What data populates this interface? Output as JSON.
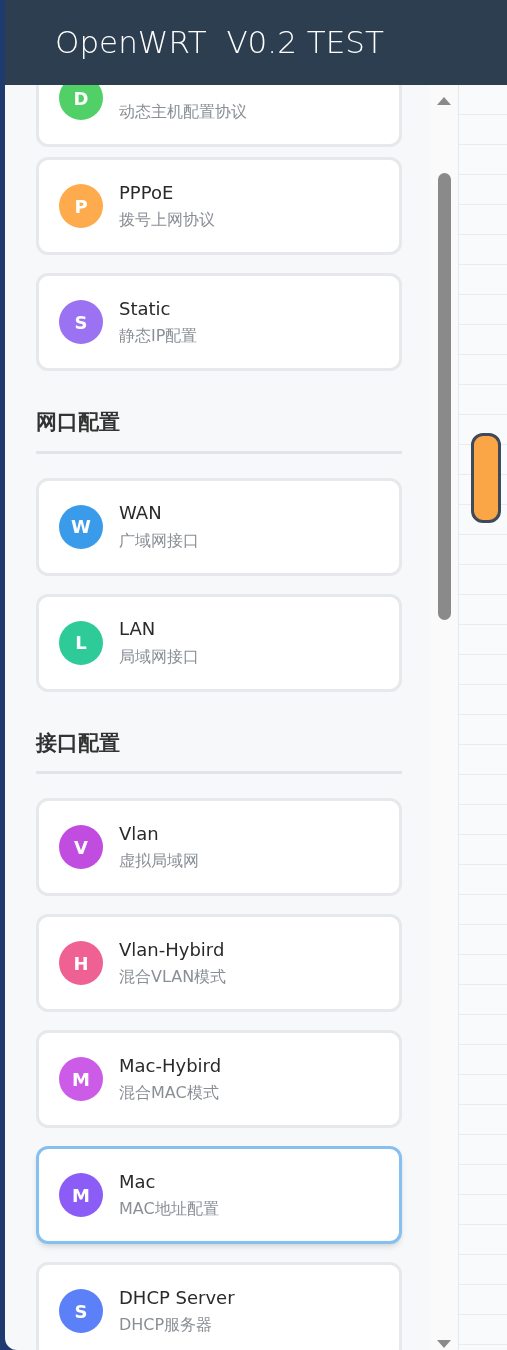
{
  "header": {
    "title": "OpenWRT  V0.2 TEST"
  },
  "sections": [
    {
      "items": [
        {
          "letter": "D",
          "subtitle": "动态主机配置协议",
          "color": "#52d068",
          "selected": false
        },
        {
          "letter": "P",
          "title": "PPPoE",
          "subtitle": "拨号上网协议",
          "color": "#fdab4d",
          "selected": false
        },
        {
          "letter": "S",
          "title": "Static",
          "subtitle": "静态IP配置",
          "color": "#9b72f2",
          "selected": false
        }
      ]
    },
    {
      "heading": "网口配置",
      "items": [
        {
          "letter": "W",
          "title": "WAN",
          "subtitle": "广域网接口",
          "color": "#3a9bea",
          "selected": false
        },
        {
          "letter": "L",
          "title": "LAN",
          "subtitle": "局域网接口",
          "color": "#2ecb98",
          "selected": false
        }
      ]
    },
    {
      "heading": "接口配置",
      "items": [
        {
          "letter": "V",
          "title": "Vlan",
          "subtitle": "虚拟局域网",
          "color": "#c04ce0",
          "selected": false
        },
        {
          "letter": "H",
          "title": "Vlan-Hybird",
          "subtitle": "混合VLAN模式",
          "color": "#ef6193",
          "selected": false
        },
        {
          "letter": "M",
          "title": "Mac-Hybird",
          "subtitle": "混合MAC模式",
          "color": "#cc5ce8",
          "selected": false
        },
        {
          "letter": "M",
          "title": "Mac",
          "subtitle": "MAC地址配置",
          "color": "#8b5cf6",
          "selected": true
        },
        {
          "letter": "S",
          "title": "DHCP Server",
          "subtitle": "DHCP服务器",
          "color": "#5b80f7",
          "selected": false
        }
      ]
    }
  ]
}
